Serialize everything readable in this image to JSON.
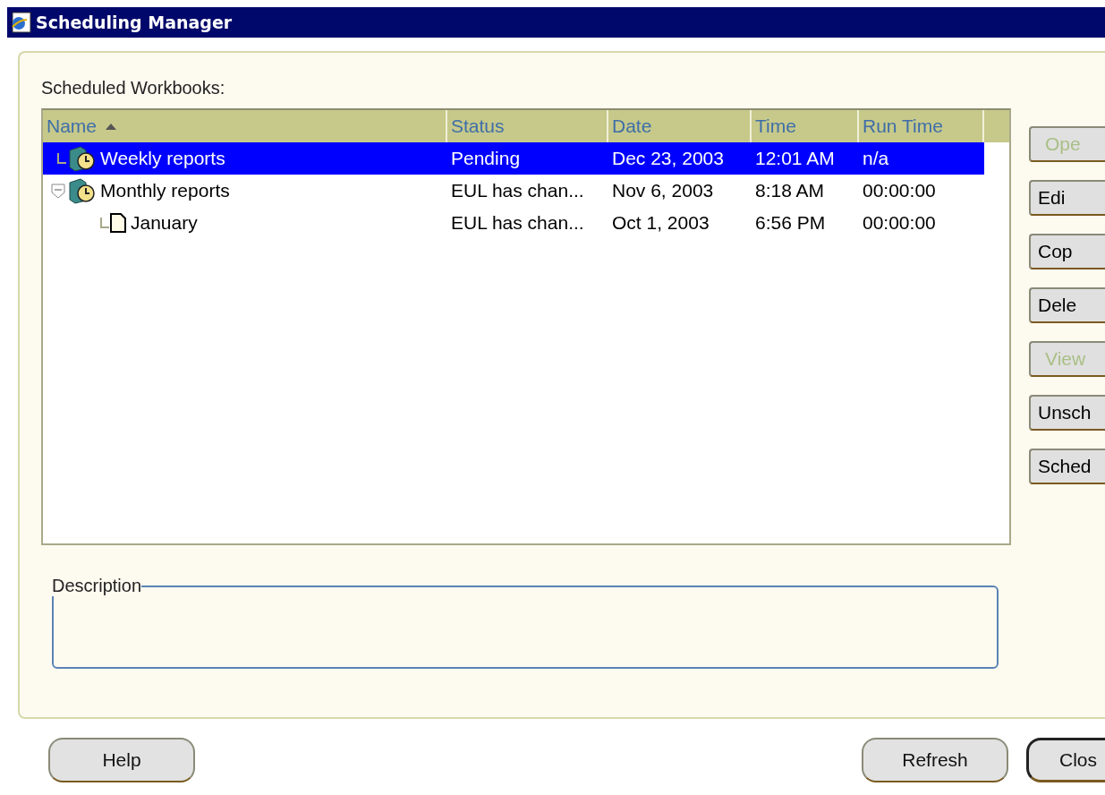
{
  "window": {
    "title": "Scheduling Manager"
  },
  "list_label": "Scheduled Workbooks:",
  "table": {
    "columns": [
      {
        "label": "Name",
        "sorted": true
      },
      {
        "label": "Status",
        "sorted": false
      },
      {
        "label": "Date",
        "sorted": false
      },
      {
        "label": "Time",
        "sorted": false
      },
      {
        "label": "Run Time",
        "sorted": false
      }
    ],
    "rows": [
      {
        "kind": "workbook",
        "name": "Weekly reports",
        "status": "Pending",
        "date": "Dec 23, 2003",
        "time": "12:01 AM",
        "run_time": "n/a",
        "selected": true
      },
      {
        "kind": "workbook",
        "name": "Monthly reports",
        "status": "EUL has chan...",
        "date": "Nov 6, 2003",
        "time": "8:18 AM",
        "run_time": "00:00:00",
        "selected": false,
        "expanded": true,
        "children": [
          {
            "kind": "sheet",
            "name": "January",
            "status": "EUL has chan...",
            "date": "Oct 1, 2003",
            "time": "6:56 PM",
            "run_time": "00:00:00",
            "selected": false
          }
        ]
      }
    ]
  },
  "description": {
    "label": "Description"
  },
  "side_buttons": [
    {
      "label": "Ope",
      "disabled": true
    },
    {
      "label": "Edi",
      "disabled": false
    },
    {
      "label": "Cop",
      "disabled": false
    },
    {
      "label": "Dele",
      "disabled": false
    },
    {
      "label": "View",
      "disabled": true
    },
    {
      "label": "Unsch",
      "disabled": false
    },
    {
      "label": "Sched",
      "disabled": false
    }
  ],
  "footer_buttons": [
    {
      "label": "Help",
      "default": false
    },
    {
      "label": "Refresh",
      "default": false
    },
    {
      "label": "Clos",
      "default": true
    }
  ]
}
